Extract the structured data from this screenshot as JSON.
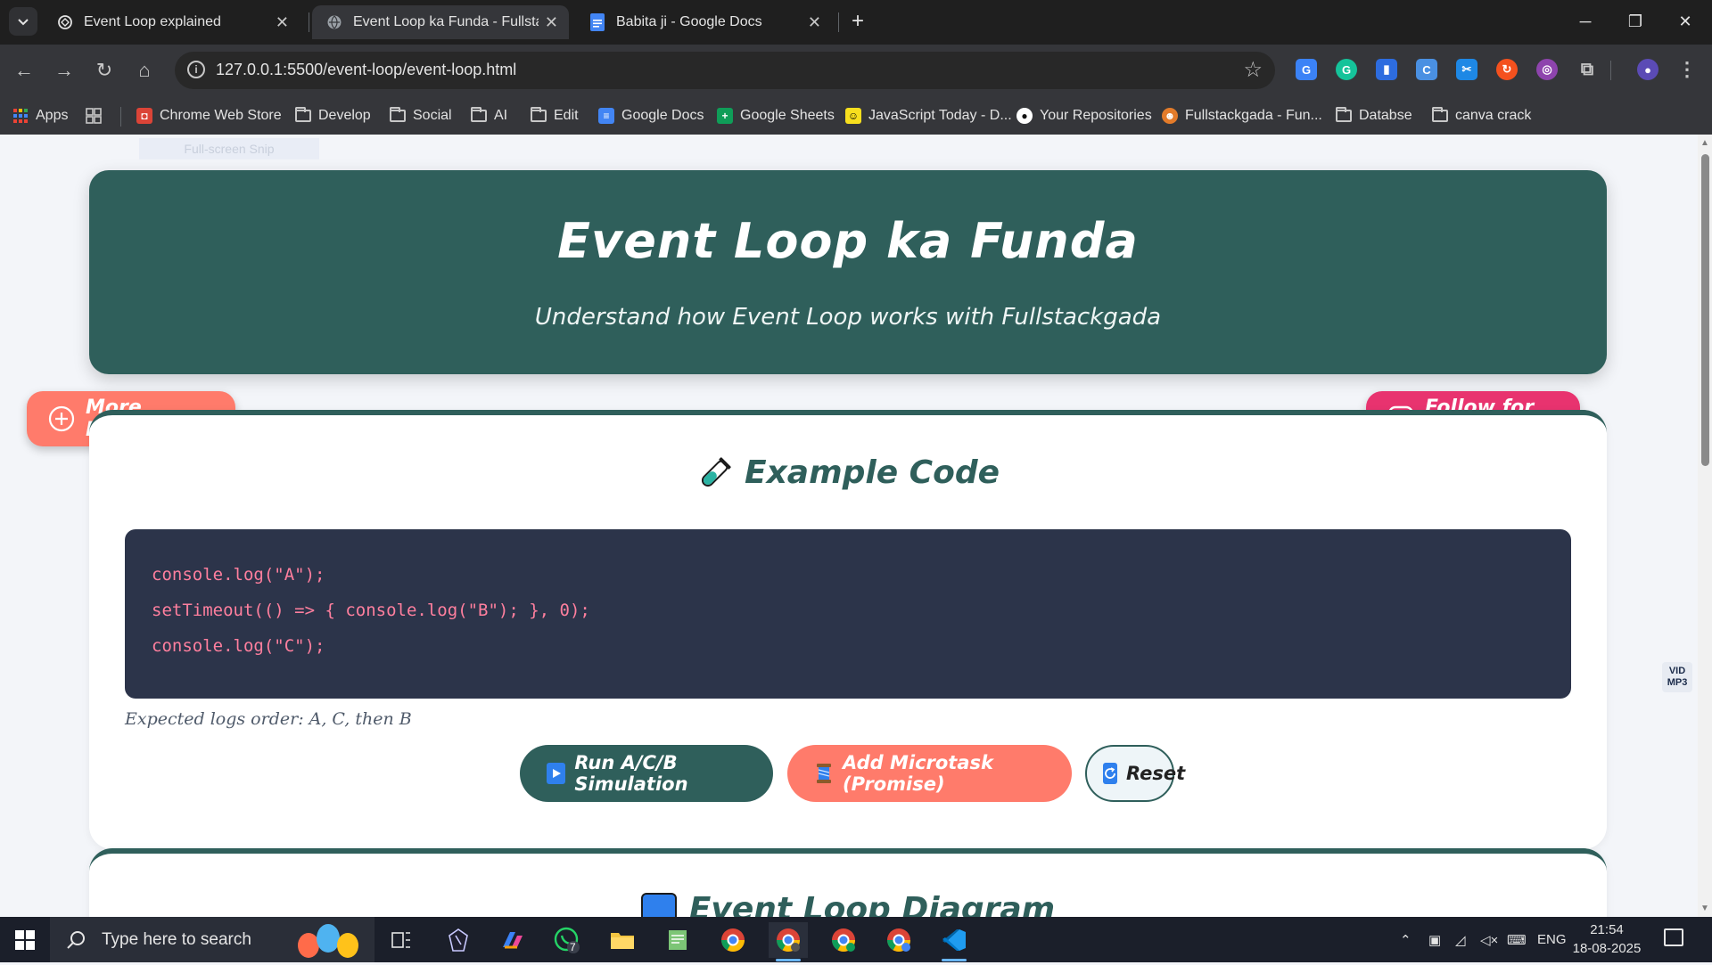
{
  "browser": {
    "tabs": [
      {
        "label": "Event Loop explained",
        "close": "✕",
        "icon": "openai-icon",
        "active": false
      },
      {
        "label": "Event Loop ka Funda - Fullstackgada",
        "close": "✕",
        "icon": "globe-icon",
        "active": true
      },
      {
        "label": "Babita ji - Google Docs",
        "close": "✕",
        "icon": "google-docs-icon",
        "active": false
      }
    ],
    "new_tab": "+",
    "window_controls": {
      "minimize": "─",
      "restore": "❐",
      "close": "✕"
    },
    "nav": {
      "back": "←",
      "forward": "→",
      "reload": "↻",
      "home": "⌂"
    },
    "url": "127.0.0.1:5500/event-loop/event-loop.html",
    "star": "☆",
    "menu": "⋮"
  },
  "bookmarks": [
    {
      "label": "Apps",
      "type": "apps"
    },
    {
      "label": "Chrome Web Store",
      "type": "site"
    },
    {
      "label": "Develop",
      "type": "folder"
    },
    {
      "label": "Social",
      "type": "folder"
    },
    {
      "label": "AI",
      "type": "folder"
    },
    {
      "label": "Edit",
      "type": "folder"
    },
    {
      "label": "Google Docs",
      "type": "site"
    },
    {
      "label": "Google Sheets",
      "type": "site"
    },
    {
      "label": "JavaScript Today - D...",
      "type": "site"
    },
    {
      "label": "Your Repositories",
      "type": "site"
    },
    {
      "label": "Fullstackgada - Fun...",
      "type": "site"
    },
    {
      "label": "Databse",
      "type": "folder"
    },
    {
      "label": "canva crack",
      "type": "folder"
    }
  ],
  "page": {
    "snip_hint": "Full-screen Snip",
    "hero": {
      "title": "Event Loop ka Funda",
      "subtitle": "Understand how Event Loop works with Fullstackgada",
      "more_button": "More Diagrams",
      "follow_button": "Follow for More"
    },
    "example": {
      "title": "Example Code",
      "code_lines": [
        "console.log(\"A\");",
        "setTimeout(() => { console.log(\"B\"); }, 0);",
        "console.log(\"C\");"
      ],
      "expected": "Expected logs order: A, C, then B",
      "run_button": "Run A/C/B Simulation",
      "micro_button": "Add Microtask (Promise)",
      "reset_button": "Reset"
    },
    "diagram": {
      "title": "Event Loop Diagram"
    },
    "vid_badge": {
      "line1": "VID",
      "line2": "MP3"
    }
  },
  "taskbar": {
    "search_placeholder": "Type here to search",
    "whatsapp_badge": "7",
    "language": "ENG",
    "time": "21:54",
    "date": "18-08-2025"
  },
  "colors": {
    "teal": "#2f5f5b",
    "coral": "#ff7b6b",
    "pink": "#e8336f",
    "code_bg": "#2c344a",
    "code_text": "#ff7f9e"
  }
}
